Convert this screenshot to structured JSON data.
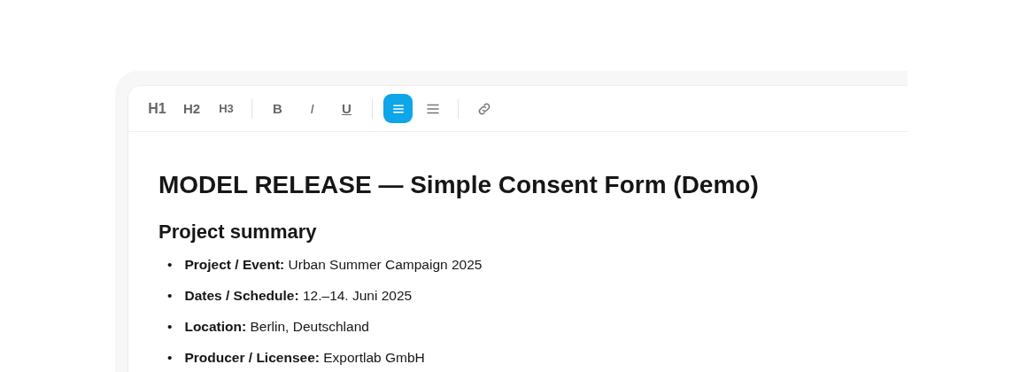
{
  "toolbar": {
    "groups": [
      {
        "items": [
          {
            "kind": "h1",
            "label": "H1",
            "selected": false
          },
          {
            "kind": "h2",
            "label": "H2",
            "selected": false
          },
          {
            "kind": "h3",
            "label": "H3",
            "selected": false
          }
        ]
      },
      {
        "items": [
          {
            "kind": "bold",
            "label": "B",
            "selected": false
          },
          {
            "kind": "italic",
            "label": "I",
            "selected": false
          },
          {
            "kind": "underline",
            "label": "U",
            "selected": false
          }
        ]
      },
      {
        "items": [
          {
            "kind": "align",
            "selected": true
          },
          {
            "kind": "lines",
            "selected": false
          }
        ]
      },
      {
        "items": [
          {
            "kind": "link",
            "selected": false
          }
        ]
      }
    ]
  },
  "document": {
    "title": "MODEL RELEASE — Simple Consent Form (Demo)",
    "section": "Project summary",
    "items": [
      {
        "marker": "•",
        "text": "**Project / Event:** Urban Summer Campaign 2025"
      },
      {
        "marker": "•",
        "text": "**Dates / Schedule:** 12.–14. Juni 2025"
      },
      {
        "marker": "•",
        "text": "**Location:** Berlin, Deutschland"
      },
      {
        "marker": "•",
        "text": "**Producer / Licensee:** Exportlab GmbH"
      }
    ]
  }
}
